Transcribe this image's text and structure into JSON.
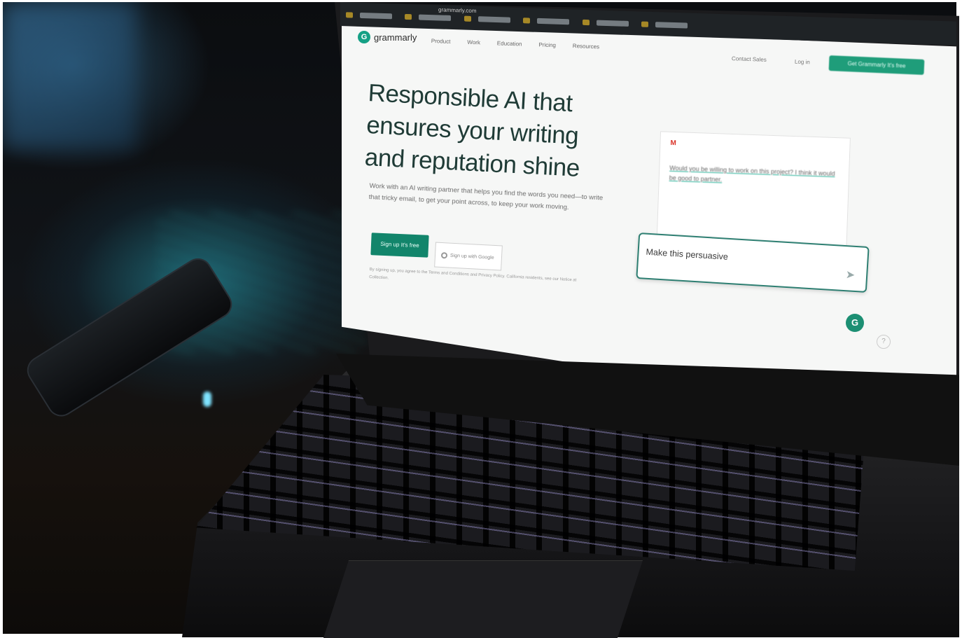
{
  "browser": {
    "url": "grammarly.com"
  },
  "site": {
    "logo_text": "grammarly",
    "logo_mark": "G",
    "nav": [
      "Product",
      "Work",
      "Education",
      "Pricing",
      "Resources"
    ],
    "contact_sales": "Contact Sales",
    "login": "Log in",
    "cta_top": "Get Grammarly It's free"
  },
  "hero": {
    "headline": "Responsible AI that ensures your writing and reputation shine",
    "subtext": "Work with an AI writing partner that helps you find the words you need—to write that tricky email, to get your point across, to keep your work moving.",
    "signup_label": "Sign up It's free",
    "google_label": "Sign up with Google",
    "terms": "By signing up, you agree to the Terms and Conditions and Privacy Policy. California residents, see our Notice at Collection."
  },
  "demo": {
    "email_icon": "M",
    "email_text": "Would you be willing to work on this project? I think it would be good to partner.",
    "prompt_text": "Make this persuasive",
    "send_icon": "send-icon"
  },
  "colors": {
    "brand": "#12856b",
    "accent": "#2e7f72"
  }
}
